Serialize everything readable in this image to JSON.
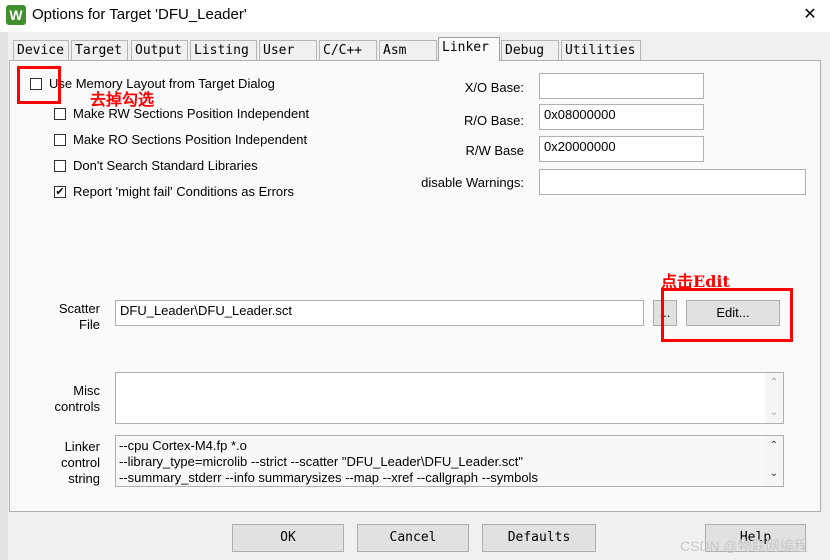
{
  "window": {
    "title": "Options for Target 'DFU_Leader'",
    "app_icon_glyph": "W"
  },
  "tabs": [
    {
      "label": "Device"
    },
    {
      "label": "Target"
    },
    {
      "label": "Output"
    },
    {
      "label": "Listing"
    },
    {
      "label": "User"
    },
    {
      "label": "C/C++"
    },
    {
      "label": "Asm"
    },
    {
      "label": "Linker",
      "active": true
    },
    {
      "label": "Debug"
    },
    {
      "label": "Utilities"
    }
  ],
  "checkboxes": {
    "use_memory_layout": {
      "label": "Use Memory Layout from Target Dialog",
      "checked": false
    },
    "rw_position_independent": {
      "label": "Make RW Sections Position Independent",
      "checked": false
    },
    "ro_position_independent": {
      "label": "Make RO Sections Position Independent",
      "checked": false
    },
    "dont_search_std_libs": {
      "label": "Don't Search Standard Libraries",
      "checked": false
    },
    "might_fail_as_errors": {
      "label": "Report 'might fail' Conditions as Errors",
      "checked": true
    }
  },
  "bases": {
    "xo": {
      "label": "X/O Base:",
      "value": ""
    },
    "ro": {
      "label": "R/O Base:",
      "value": "0x08000000"
    },
    "rw": {
      "label": "R/W Base",
      "value": "0x20000000"
    },
    "disable_warnings": {
      "label": "disable Warnings:",
      "value": ""
    }
  },
  "scatter": {
    "label_line1": "Scatter",
    "label_line2": "File",
    "value": "DFU_Leader\\DFU_Leader.sct",
    "browse_label": "...",
    "edit_label": "Edit..."
  },
  "misc": {
    "label_line1": "Misc",
    "label_line2": "controls",
    "value": ""
  },
  "linker_control": {
    "label_line1": "Linker",
    "label_line2": "control",
    "label_line3": "string",
    "lines": [
      "--cpu Cortex-M4.fp *.o",
      "--library_type=microlib --strict --scatter \"DFU_Leader\\DFU_Leader.sct\"",
      "--summary_stderr --info summarysizes --map --xref --callgraph --symbols"
    ]
  },
  "buttons": {
    "ok": "OK",
    "cancel": "Cancel",
    "defaults": "Defaults",
    "help": "Help"
  },
  "annotations": {
    "uncheck": "去掉勾选",
    "click_edit": "点击Edit",
    "color": "#ff0000"
  },
  "watermark": "CSDN @物联网编程"
}
